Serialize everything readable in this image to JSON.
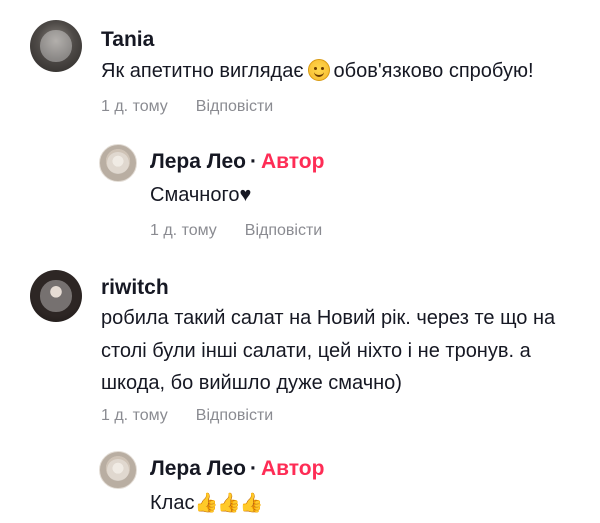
{
  "comments": [
    {
      "author": "Tania",
      "text_before": "Як апетитно виглядає",
      "emoji": "smiling-face-icon",
      "text_after": "обов'язково спробую!",
      "time": "1 д. тому",
      "reply_label": "Відповісти"
    },
    {
      "author": "Лера Лео",
      "separator": "·",
      "badge": "Автор",
      "text": "Смачного♥",
      "time": "1 д. тому",
      "reply_label": "Відповісти"
    },
    {
      "author": "riwitch",
      "lines": [
        "робила такий салат на Новий рік. через те що на",
        "столі були інші салати, цей ніхто і не тронув. а",
        "шкода, бо вийшло дуже смачно)"
      ],
      "time": "1 д. тому",
      "reply_label": "Відповісти"
    },
    {
      "author": "Лера Лео",
      "separator": "·",
      "badge": "Автор",
      "text": "Клас",
      "emoji_suffix": "👍👍👍"
    }
  ],
  "colors": {
    "author_badge": "#fe2c55",
    "meta": "#8a8b91",
    "text": "#161823"
  }
}
